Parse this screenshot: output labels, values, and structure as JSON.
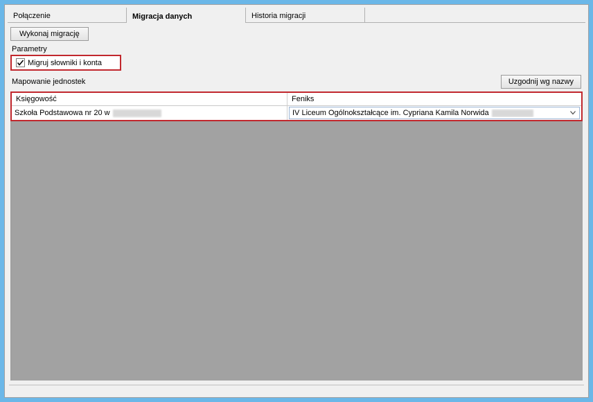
{
  "tabs": {
    "connection": "Połączenie",
    "migration": "Migracja danych",
    "history": "Historia migracji"
  },
  "toolbar": {
    "run_migration": "Wykonaj migrację"
  },
  "params": {
    "section_label": "Parametry",
    "migrate_dicts_label": "Migruj słowniki i konta",
    "checked": true
  },
  "mapping": {
    "section_label": "Mapowanie jednostek",
    "align_button": "Uzgodnij wg nazwy"
  },
  "table": {
    "col_accounting": "Księgowość",
    "col_feniks": "Feniks",
    "rows": [
      {
        "accounting": "Szkoła Podstawowa nr 20 w",
        "feniks": "IV Liceum Ogólnokształcące im. Cypriana Kamila Norwida"
      }
    ]
  },
  "icons": {
    "chevron_down": "chevron-down-icon",
    "checkmark": "checkmark-icon"
  }
}
